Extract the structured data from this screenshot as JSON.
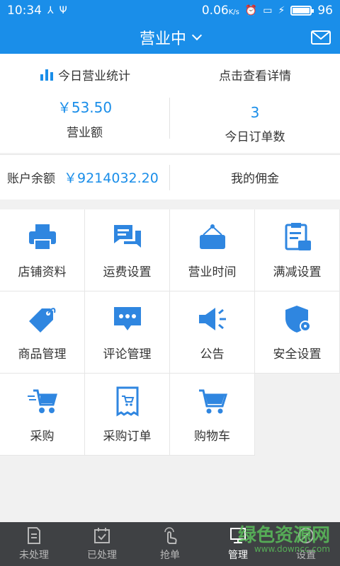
{
  "status_bar": {
    "time": "10:34",
    "network_speed": "0.06",
    "network_unit": "K/s",
    "battery": "96"
  },
  "header": {
    "title": "营业中"
  },
  "stats": {
    "title": "今日营业统计",
    "details_link": "点击查看详情",
    "revenue_value": "￥53.50",
    "revenue_label": "营业额",
    "orders_value": "3",
    "orders_label": "今日订单数"
  },
  "balance": {
    "label": "账户余额",
    "value": "￥9214032.20",
    "commission": "我的佣金"
  },
  "grid": {
    "items": [
      {
        "label": "店铺资料",
        "icon": "printer-icon"
      },
      {
        "label": "运费设置",
        "icon": "chat-icon"
      },
      {
        "label": "营业时间",
        "icon": "sign-icon"
      },
      {
        "label": "满减设置",
        "icon": "clipboard-icon"
      },
      {
        "label": "商品管理",
        "icon": "tag-icon"
      },
      {
        "label": "评论管理",
        "icon": "comment-icon"
      },
      {
        "label": "公告",
        "icon": "megaphone-icon"
      },
      {
        "label": "安全设置",
        "icon": "shield-icon"
      },
      {
        "label": "采购",
        "icon": "fast-cart-icon"
      },
      {
        "label": "采购订单",
        "icon": "receipt-icon"
      },
      {
        "label": "购物车",
        "icon": "cart-icon"
      }
    ]
  },
  "tabbar": {
    "items": [
      {
        "label": "未处理",
        "icon": "document-icon"
      },
      {
        "label": "已处理",
        "icon": "calendar-check-icon"
      },
      {
        "label": "抢单",
        "icon": "hand-tap-icon"
      },
      {
        "label": "管理",
        "icon": "monitor-icon"
      },
      {
        "label": "设置",
        "icon": "wrench-icon"
      }
    ],
    "active_index": 3
  },
  "watermark": {
    "text": "绿色资源网",
    "url": "www.downcc.com"
  },
  "colors": {
    "primary": "#1a8ee9",
    "tabbar_bg": "#3f4144"
  }
}
